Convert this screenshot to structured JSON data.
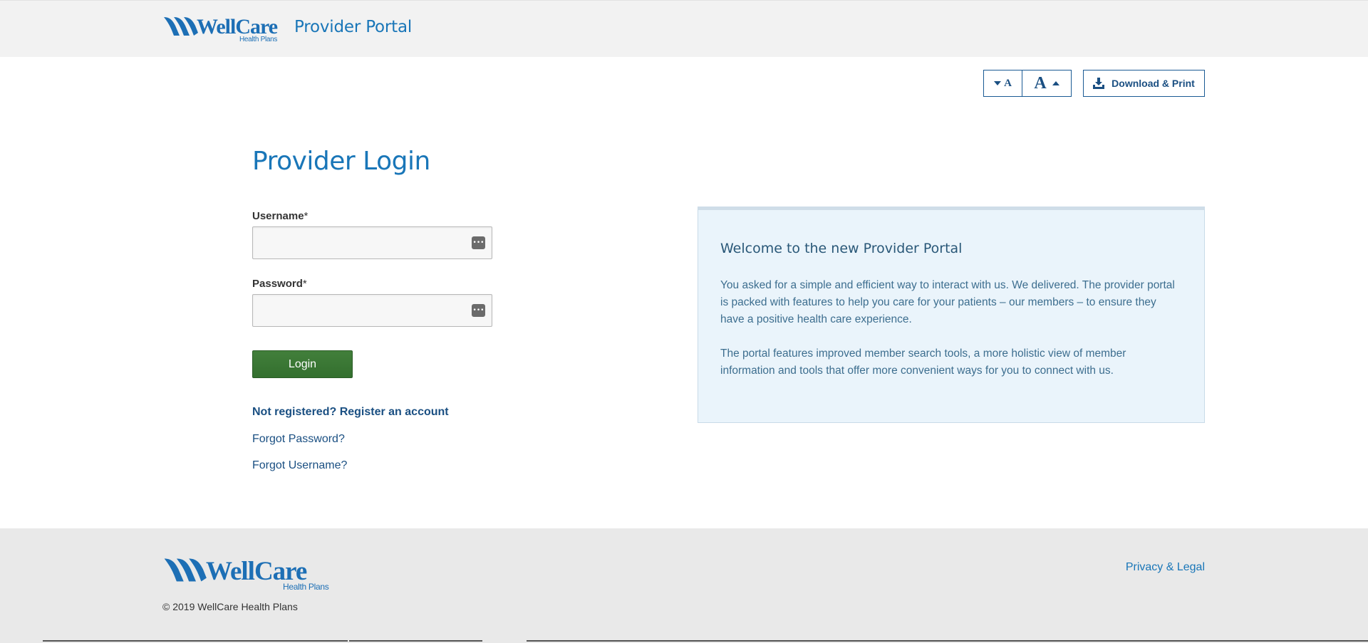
{
  "header": {
    "logo_text": "WellCare",
    "logo_sub": "Health Plans",
    "portal_title": "Provider Portal"
  },
  "toolbar": {
    "font_decrease_label": "A",
    "font_increase_label": "A",
    "download_label": "Download & Print",
    "icons": {
      "decrease": "caret-down-icon",
      "increase": "caret-up-icon",
      "download": "download-icon"
    }
  },
  "login": {
    "title": "Provider Login",
    "username_label": "Username",
    "password_label": "Password",
    "required_marker": "*",
    "username_value": "",
    "password_value": "",
    "login_button": "Login",
    "register_link": "Not registered? Register an account",
    "forgot_password": "Forgot Password?",
    "forgot_username": "Forgot Username?",
    "field_icon": "password-manager-icon",
    "field_icon_glyph": "•••"
  },
  "welcome": {
    "title": "Welcome to the new Provider Portal",
    "paragraph1": "You asked for a simple and efficient way to interact with us. We delivered. The provider portal is packed with features to help you care for your patients – our members – to ensure they have a positive health care experience.",
    "paragraph2": "The portal features improved member search tools, a more holistic view of member information and tools that offer more convenient ways for you to connect with us."
  },
  "footer": {
    "logo_text": "WellCare",
    "logo_sub": "Health Plans",
    "copyright": "© 2019 WellCare Health Plans",
    "privacy_link": "Privacy & Legal"
  },
  "colors": {
    "brand_blue": "#1976b8",
    "link_dark_blue": "#1a4f82",
    "login_green": "#3a7a34",
    "header_bg": "#f2f2f2",
    "footer_bg": "#e9e9e9",
    "panel_bg": "#eaf4fb"
  }
}
